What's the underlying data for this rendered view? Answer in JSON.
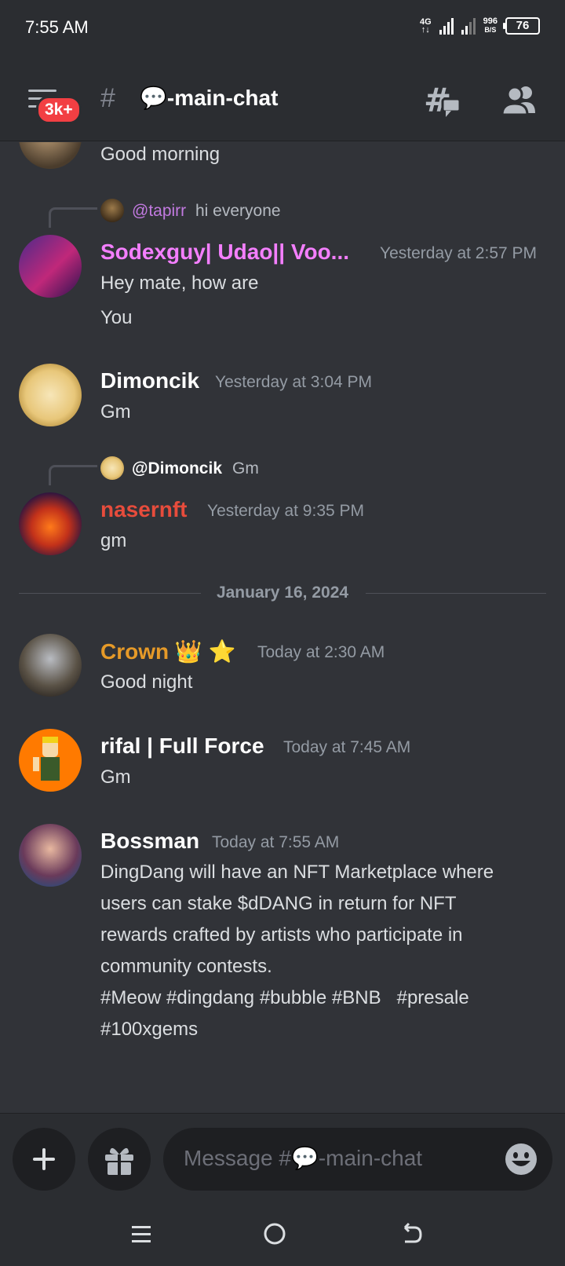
{
  "status_bar": {
    "time": "7:55 AM",
    "network": "4G",
    "speed_value": "996",
    "speed_unit": "B/S",
    "battery": "76"
  },
  "header": {
    "unread_badge": "3k+",
    "channel_name": "💬-main-chat"
  },
  "messages": [
    {
      "id": "m0",
      "text": "Good morning"
    },
    {
      "id": "m1",
      "reply": {
        "name": "@tapirr",
        "text": "hi everyone"
      },
      "username": "Sodexguy| Udao|| Voo...",
      "username_color": "#f47fff",
      "timestamp": "Yesterday at 2:57 PM",
      "lines": [
        "Hey mate, how are",
        "You"
      ]
    },
    {
      "id": "m2",
      "username": "Dimoncik",
      "username_color": "#ffffff",
      "timestamp": "Yesterday at 3:04 PM",
      "text": "Gm"
    },
    {
      "id": "m3",
      "reply": {
        "name": "@Dimoncik",
        "text": "Gm"
      },
      "username": "nasernft",
      "username_color": "#e74c3c",
      "timestamp": "Yesterday at 9:35 PM",
      "text": "gm"
    },
    {
      "id": "m4",
      "username": "Crown 👑 ⭐",
      "username_color": "#e69a28",
      "timestamp": "Today at 2:30 AM",
      "text": "Good night"
    },
    {
      "id": "m5",
      "username": "rifal | Full Force",
      "username_color": "#ffffff",
      "timestamp": "Today at 7:45 AM",
      "text": "Gm"
    },
    {
      "id": "m6",
      "username": "Bossman",
      "username_color": "#ffffff",
      "timestamp": "Today at 7:55 AM",
      "lines": [
        "DingDang will have an NFT Marketplace where",
        "users can stake $dDANG in return for NFT",
        "rewards crafted by artists who participate in",
        "community contests.",
        "#Meow #dingdang #bubble #BNB   #presale",
        "#100xgems"
      ]
    }
  ],
  "date_divider": "January 16, 2024",
  "composer": {
    "placeholder": "Message #💬-main-chat"
  },
  "colors": {
    "background": "#313338",
    "header": "#2b2d31",
    "badge": "#f23f43",
    "reply_name_tapirr": "#c27ae0"
  }
}
